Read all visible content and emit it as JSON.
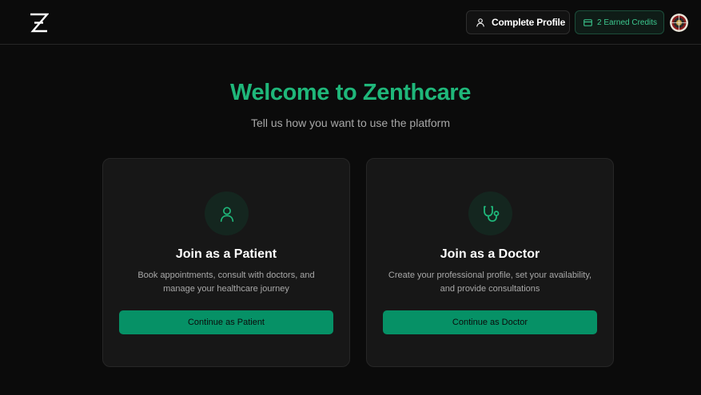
{
  "header": {
    "logo_icon": "zenthcare-z-logo",
    "complete_profile_label": "Complete Profile",
    "credits_label": "2 Earned Credits",
    "avatar_icon": "user-avatar"
  },
  "hero": {
    "title": "Welcome to Zenthcare",
    "subtitle": "Tell us how you want to use the platform"
  },
  "cards": {
    "patient": {
      "icon": "user-icon",
      "title": "Join as a Patient",
      "description": "Book appointments, consult with doctors, and manage your healthcare journey",
      "button_label": "Continue as Patient"
    },
    "doctor": {
      "icon": "stethoscope-icon",
      "title": "Join as a Doctor",
      "description": "Create your professional profile, set your availability, and provide consultations",
      "button_label": "Continue as Doctor"
    }
  },
  "colors": {
    "accent": "#1fb77a",
    "button_bg": "#069166",
    "background": "#0b0b0b",
    "card_bg": "#171717"
  }
}
